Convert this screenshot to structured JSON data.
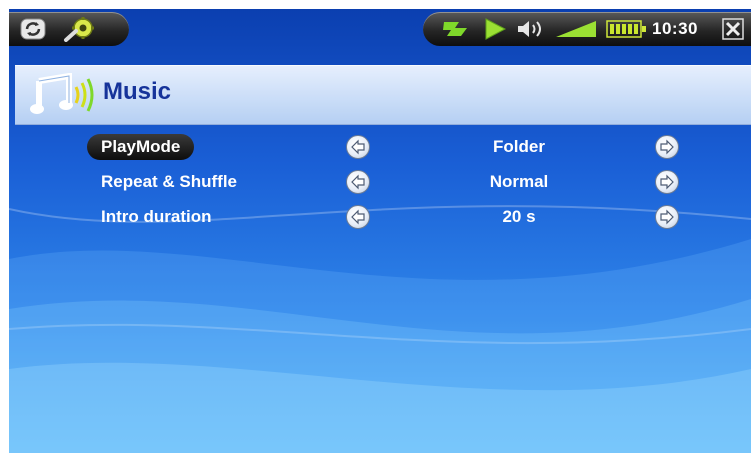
{
  "status_bar": {
    "time": "10:30",
    "left_icons": [
      "sync-icon",
      "settings-wrench-icon"
    ],
    "right_icons": [
      "usb-icon",
      "play-icon",
      "volume-icon",
      "volume-level-icon",
      "battery-icon",
      "close-icon"
    ]
  },
  "header": {
    "title": "Music",
    "icon": "music-note-icon"
  },
  "settings": [
    {
      "label": "PlayMode",
      "value": "Folder",
      "selected": true
    },
    {
      "label": "Repeat & Shuffle",
      "value": "Normal",
      "selected": false
    },
    {
      "label": "Intro duration",
      "value": "20 s",
      "selected": false
    }
  ],
  "colors": {
    "accent_green": "#7fd82a",
    "header_text": "#16339a",
    "background_top": "#0b3fb0",
    "background_bottom": "#53b3f7"
  }
}
